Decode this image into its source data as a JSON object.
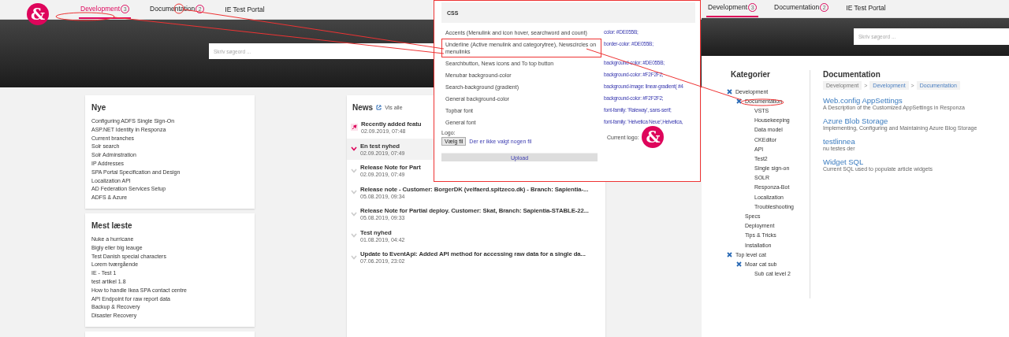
{
  "left_portal": {
    "logo": "&",
    "nav": [
      {
        "label": "Development",
        "badge": "3",
        "selected": true
      },
      {
        "label": "Documentation",
        "badge": "2",
        "selected": false
      },
      {
        "label": "IE Test Portal",
        "selected": false
      }
    ],
    "search": {
      "placeholder": "Skriv søgeord ..."
    },
    "nye": {
      "title": "Nye",
      "items": [
        "Configuring ADFS Single Sign-On",
        "ASP.NET Identity in Responza",
        "Current branches",
        "Solr search",
        "Solr Adminstration",
        "IP Addresses",
        "SPA Portal Specification and Design",
        "Localization API",
        "AD Federation Services Setup",
        "ADFS & Azure"
      ]
    },
    "mest_laeste": {
      "title": "Mest læste",
      "items": [
        "Nuke a hurricane",
        "Bigly eller big leauge",
        "Test Danish special characters",
        "Lorem tværgående",
        "IE - Test 1",
        "test artikel 1.8",
        "How to handle Ikea SPA contact centre",
        "API Endpoint for raw report data",
        "Backup & Recovery",
        "Disaster Recovery"
      ]
    },
    "news": {
      "title": "News",
      "link": "Vis alle",
      "items": [
        {
          "title": "Recently added featu",
          "date": "02.09.2019, 07:48",
          "kind": "pinned",
          "selected": false
        },
        {
          "title": "En test nyhed",
          "date": "02.09.2019, 07:49",
          "kind": "chevron",
          "selected": true
        },
        {
          "title": "Release Note for Part",
          "date": "02.09.2019, 07:49",
          "kind": "chevron",
          "selected": false
        },
        {
          "title": "Release note - Customer: BorgerDK (velfaerd.spitzeco.dk) - Branch: Sapientia-...",
          "date": "05.08.2019, 09:34",
          "kind": "chevron",
          "selected": false
        },
        {
          "title": "Release Note for Partial deploy. Customer: Skat, Branch: Sapientia-STABLE-22...",
          "date": "05.08.2019, 09:33",
          "kind": "chevron",
          "selected": false
        },
        {
          "title": "Test nyhed",
          "date": "01.08.2019, 04:42",
          "kind": "chevron",
          "selected": false
        },
        {
          "title": "Update to EventApi: Added API method for accessing raw data for a single da...",
          "date": "07.06.2019, 23:02",
          "kind": "chevron",
          "selected": false
        }
      ]
    }
  },
  "css_panel": {
    "title": "CSS",
    "rows": [
      {
        "label": "Accents (Menulink and icon hover, searchword and count)",
        "value": "color: #DE055B;",
        "highlighted": false
      },
      {
        "label": "Underline (Active menulink and categorytree), Newscircles on menulinks",
        "value": "border-color: #DE055B;",
        "highlighted": true
      },
      {
        "label": "Searchbutton, News icons and To top button",
        "value": "background-color: #DE055B;",
        "highlighted": false
      },
      {
        "label": "Menubar background-color",
        "value": "background-color: #F2F2F2;",
        "highlighted": false
      },
      {
        "label": "Search-background (gradient)",
        "value": "background-image: linear-gradient( #4",
        "highlighted": false
      },
      {
        "label": "General background-color",
        "value": "background-color: #F2F2F2;",
        "highlighted": false
      },
      {
        "label": "Topbar font",
        "value": "font-family: 'Raleway', sans-serif;",
        "highlighted": false
      },
      {
        "label": "General font",
        "value": "font-family: 'Helvetica Neue',Helvetica,",
        "highlighted": false
      }
    ],
    "logo_label": "Logo:",
    "file_button": "Vælg fil",
    "file_status": "Der er ikke valgt nogen fil",
    "current_logo_label": "Current logo:",
    "current_logo": "&",
    "upload_button": "Upload"
  },
  "right_portal": {
    "nav": [
      {
        "label": "Development",
        "badge": "3",
        "selected": true
      },
      {
        "label": "Documentation",
        "badge": "2",
        "selected": false
      },
      {
        "label": "IE Test Portal",
        "selected": false
      }
    ],
    "search": {
      "placeholder": "Skriv søgeord ..."
    },
    "categories": {
      "title": "Kategorier",
      "tree": [
        {
          "label": "Development",
          "expanded": true,
          "children": [
            {
              "label": "Documentation",
              "expanded": true,
              "children": [
                {
                  "label": "VSTS"
                },
                {
                  "label": "Housekeeping"
                },
                {
                  "label": "Data model"
                },
                {
                  "label": "CKEditor"
                },
                {
                  "label": "API"
                },
                {
                  "label": "Test2"
                },
                {
                  "label": "Single sign-on"
                },
                {
                  "label": "SOLR"
                },
                {
                  "label": "Responza-Bot"
                },
                {
                  "label": "Localization"
                },
                {
                  "label": "Troubleshooting"
                }
              ]
            },
            {
              "label": "Specs"
            },
            {
              "label": "Deployment"
            },
            {
              "label": "Tips & Tricks"
            },
            {
              "label": "Installation"
            }
          ]
        },
        {
          "label": "Top level cat",
          "expanded": true,
          "children": [
            {
              "label": "Moar cat sub",
              "expanded": true,
              "children": [
                {
                  "label": "Sub cat level 2"
                }
              ]
            }
          ]
        }
      ]
    },
    "documentation": {
      "title": "Documentation",
      "breadcrumb": [
        "Development",
        "Development",
        "Documentation"
      ],
      "breadcrumb_separators": [
        ">",
        ">"
      ],
      "articles": [
        {
          "title": "Web.config AppSettings",
          "description": "A Description of the Customized AppSettings in Responza"
        },
        {
          "title": "Azure Blob Storage",
          "description": "Implementing, Configuring and Maintaining Azure Blog Storage"
        },
        {
          "title": "testlinnea",
          "description": "nu testes der"
        },
        {
          "title": "Widget SQL",
          "description": "Current SQL used to populate article widgets"
        }
      ]
    }
  }
}
